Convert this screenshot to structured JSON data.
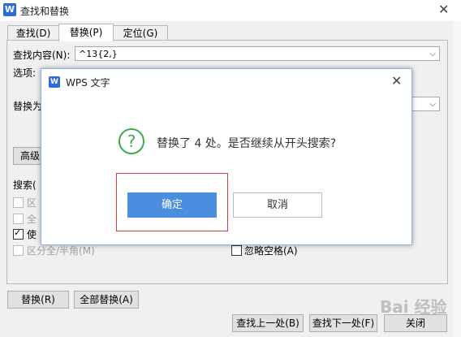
{
  "window": {
    "title": "查找和替换",
    "close_glyph": "✕",
    "icon_letter": "W"
  },
  "tabs": [
    {
      "label": "查找(D)",
      "active": false
    },
    {
      "label": "替换(P)",
      "active": true
    },
    {
      "label": "定位(G)",
      "active": false
    }
  ],
  "form": {
    "find_label": "查找内容(N):",
    "find_value": "^13{2,}",
    "options_label": "选项:",
    "replace_label": "替换为",
    "advanced_button": "高级",
    "search_label": "搜索(",
    "options": [
      {
        "label": "区",
        "checked": false,
        "disabled": true
      },
      {
        "label": "全",
        "checked": false,
        "disabled": true
      },
      {
        "label": "使",
        "checked": true,
        "disabled": false
      },
      {
        "label": "区分全/半角(M)",
        "checked": false,
        "disabled": true
      }
    ],
    "ignore_space": {
      "label": "忽略空格(A)",
      "checked": false
    }
  },
  "buttons": {
    "replace": "替换(R)",
    "replace_all": "全部替换(A)",
    "find_prev": "查找上一处(B)",
    "find_next": "查找下一处(F)",
    "close": "关闭"
  },
  "dialog": {
    "title": "WPS 文字",
    "close_glyph": "✕",
    "icon_letter": "W",
    "question_glyph": "?",
    "message": "替换了 4 处。是否继续从开头搜索?",
    "ok": "确定",
    "cancel": "取消"
  },
  "watermark": "Bai 经验"
}
